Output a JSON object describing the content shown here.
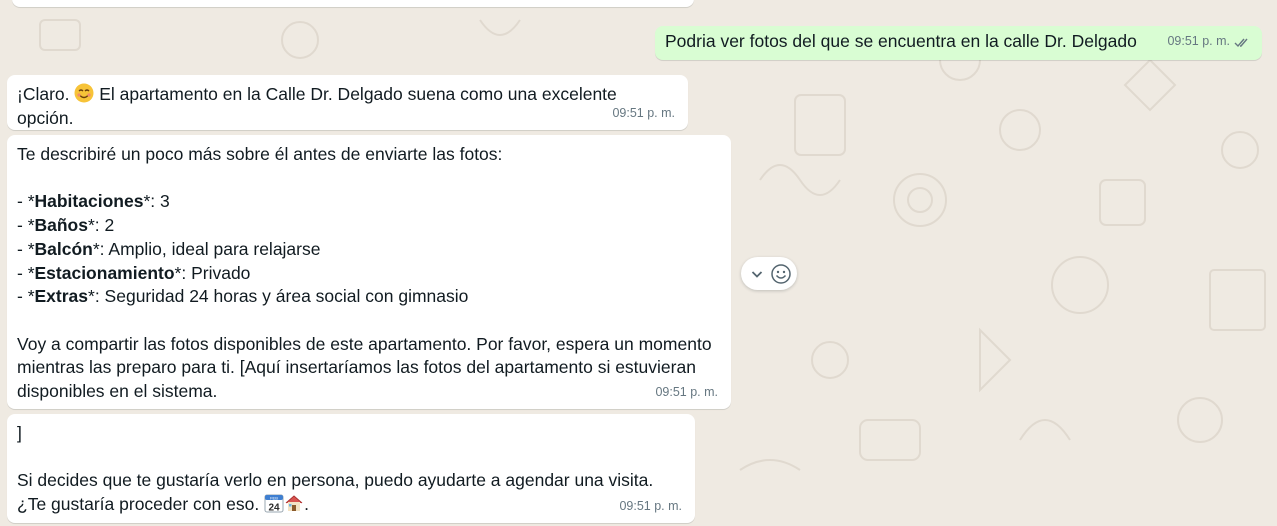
{
  "chat": {
    "messages": [
      {
        "direction": "outgoing",
        "text": "Podria ver fotos del que se encuentra en la calle Dr. Delgado",
        "time": "09:51 p. m.",
        "status": "read"
      },
      {
        "direction": "incoming",
        "text_before": "¡Claro. ",
        "emoji": "smiling-face-emoji",
        "text_after": " El apartamento en la Calle Dr. Delgado suena como una excelente opción.",
        "time": "09:51 p. m."
      },
      {
        "direction": "incoming",
        "intro": "Te describiré un poco más sobre él antes de enviarte las fotos:",
        "details": [
          {
            "prefix": "- *",
            "label": "Habitaciones",
            "suffix": "*: 3"
          },
          {
            "prefix": "- *",
            "label": "Baños",
            "suffix": "*: 2"
          },
          {
            "prefix": "- *",
            "label": "Balcón",
            "suffix": "*: Amplio, ideal para relajarse"
          },
          {
            "prefix": "- *",
            "label": "Estacionamiento",
            "suffix": "*: Privado"
          },
          {
            "prefix": "- *",
            "label": "Extras",
            "suffix": "*: Seguridad 24 horas y área social con gimnasio"
          }
        ],
        "outro": "Voy a compartir las fotos disponibles de este apartamento. Por favor, espera un momento mientras las preparo para ti. [Aquí insertaríamos las fotos del apartamento si estuvieran disponibles en el sistema.",
        "time": "09:51 p. m."
      },
      {
        "direction": "incoming",
        "first_line": "]",
        "text": "Si decides que te gustaría verlo en persona, puedo ayudarte a agendar una visita. ¿Te gustaría proceder con eso. ",
        "calendar_day": "24",
        "calendar_month": "FEB",
        "emojis": [
          "calendar-emoji",
          "house-emoji"
        ],
        "end": ".",
        "time": "09:51 p. m."
      }
    ]
  },
  "icons": {
    "message_menu": "chevron-down-icon",
    "react": "smiley-react-icon",
    "read_receipt": "double-check-icon"
  },
  "colors": {
    "wallpaper": "#efeae2",
    "incoming_bubble": "#ffffff",
    "outgoing_bubble": "#d9fdd3",
    "meta_text": "#667781",
    "read_ticks": "#667781"
  }
}
